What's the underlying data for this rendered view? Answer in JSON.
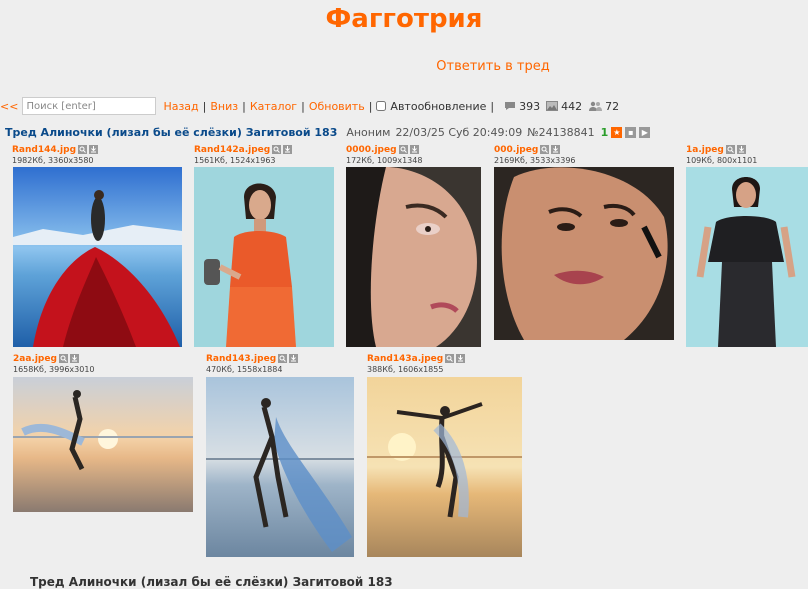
{
  "board": {
    "title": "Фагготрия"
  },
  "reply_link": "Ответить в тред",
  "toolbar": {
    "back_arrow": "<<",
    "search_placeholder": "Поиск [enter]",
    "nav": [
      "Назад",
      "Вниз",
      "Каталог",
      "Обновить"
    ],
    "separator": "|",
    "autoupdate_label": "Автообновление",
    "stats": {
      "posts": "393",
      "images": "442",
      "users": "72"
    }
  },
  "thread": {
    "title": "Тред Алиночки (лизал бы её слёзки) Загитовой 183",
    "author": "Аноним",
    "datetime": "22/03/25 Суб 20:49:09",
    "post_number": "№24138841",
    "reply_count": "1"
  },
  "files": [
    {
      "name": "Rand144.jpg",
      "meta": "1982Кб, 3360x3580"
    },
    {
      "name": "Rand142a.jpeg",
      "meta": "1561Кб, 1524x1963"
    },
    {
      "name": "0000.jpeg",
      "meta": "172Кб, 1009x1348"
    },
    {
      "name": "000.jpeg",
      "meta": "2169Кб, 3533x3396"
    },
    {
      "name": "1a.jpeg",
      "meta": "109Кб, 800x1101"
    },
    {
      "name": "2aa.jpeg",
      "meta": "1658Кб, 3996x3010"
    },
    {
      "name": "Rand143.jpeg",
      "meta": "470Кб, 1558x1884"
    },
    {
      "name": "Rand143a.jpeg",
      "meta": "388Кб, 1606x1855"
    }
  ],
  "bottom_title": "Тред Алиночки (лизал бы её слёзки) Загитовой 183",
  "colors": {
    "accent": "#ff6600",
    "thread_title": "#0a4a8a",
    "background": "#eeeeee"
  }
}
